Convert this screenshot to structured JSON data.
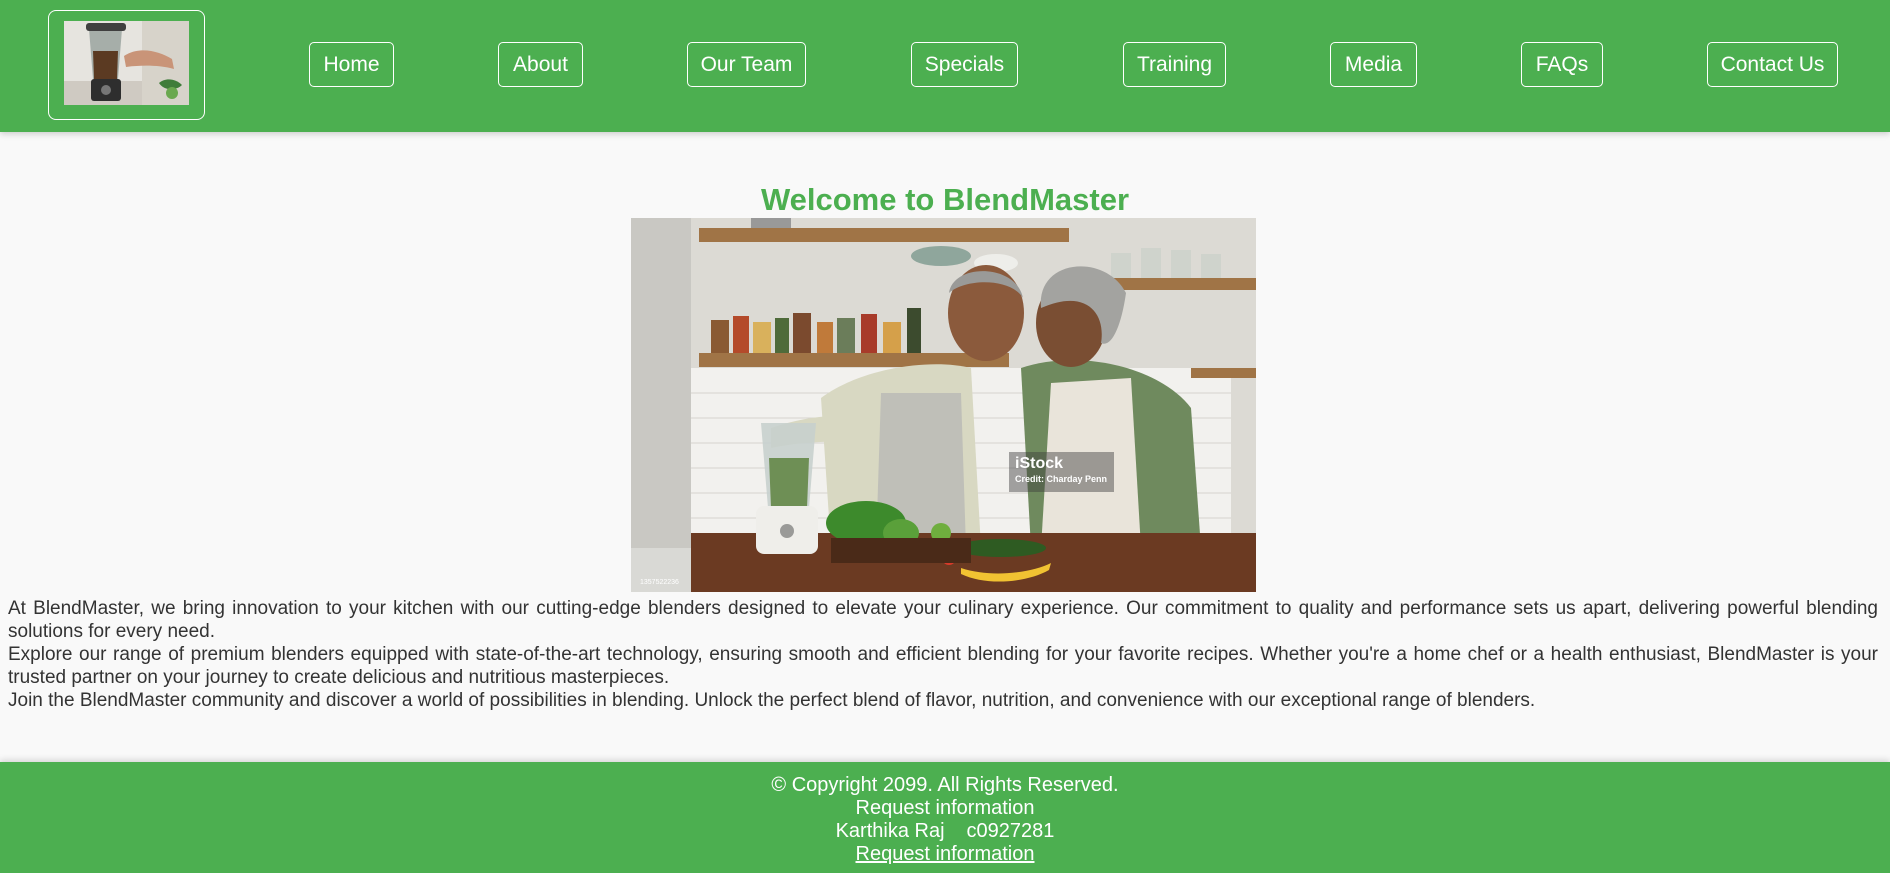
{
  "nav": {
    "items": [
      {
        "label": "Home"
      },
      {
        "label": "About"
      },
      {
        "label": "Our Team"
      },
      {
        "label": "Specials"
      },
      {
        "label": "Training"
      },
      {
        "label": "Media"
      },
      {
        "label": "FAQs"
      },
      {
        "label": "Contact Us"
      }
    ]
  },
  "main": {
    "title": "Welcome to BlendMaster",
    "hero_watermark": "iStock",
    "hero_credit": "Credit: Charday Penn",
    "hero_id": "1357522236",
    "paragraphs": [
      "At BlendMaster, we bring innovation to your kitchen with our cutting-edge blenders designed to elevate your culinary experience. Our commitment to quality and performance sets us apart, delivering powerful blending solutions for every need.",
      "Explore our range of premium blenders equipped with state-of-the-art technology, ensuring smooth and efficient blending for your favorite recipes. Whether you're a home chef or a health enthusiast, BlendMaster is your trusted partner on your journey to create delicious and nutritious masterpieces.",
      "Join the BlendMaster community and discover a world of possibilities in blending. Unlock the perfect blend of flavor, nutrition, and convenience with our exceptional range of blenders."
    ]
  },
  "footer": {
    "copyright": "© Copyright 2099. All Rights Reserved.",
    "request_text": "Request information",
    "author_name": "Karthika Raj",
    "author_id": "c0927281",
    "request_link": "Request information"
  },
  "colors": {
    "brand_green": "#4caf50",
    "page_background": "#f9f9f9",
    "text": "#333333"
  }
}
